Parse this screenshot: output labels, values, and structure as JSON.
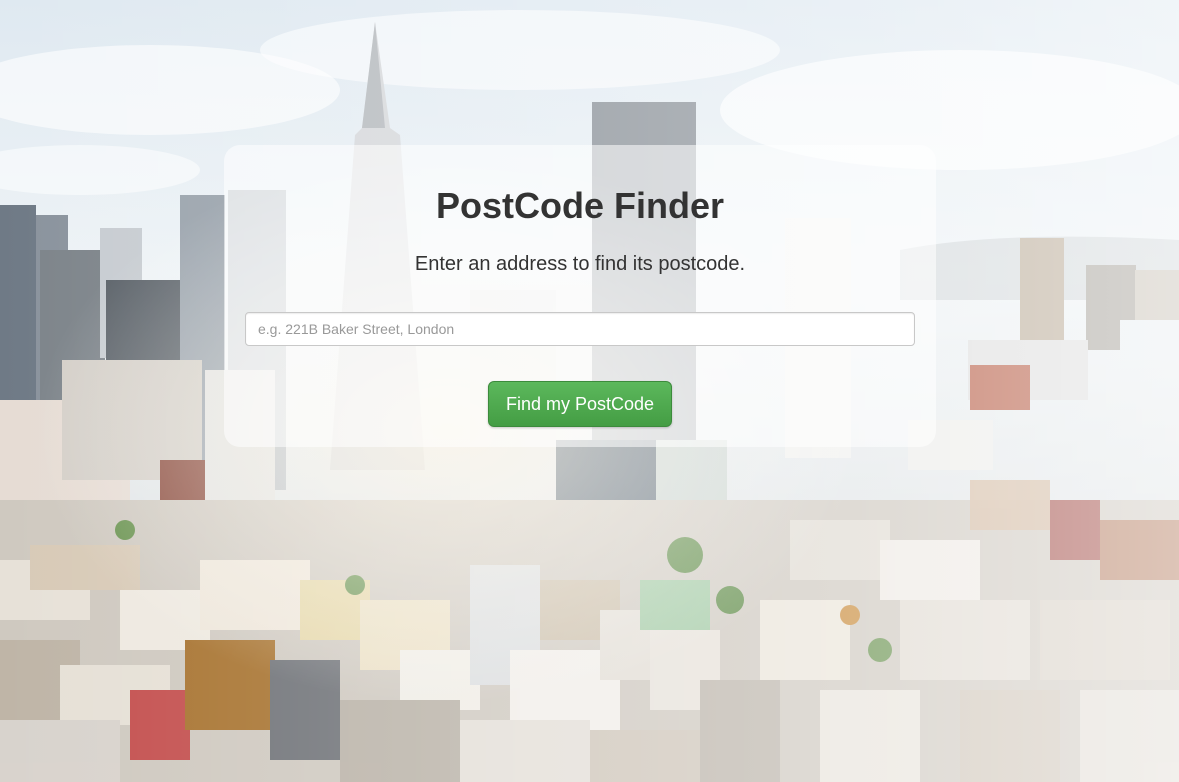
{
  "app": {
    "title": "PostCode Finder",
    "subtitle": "Enter an address to find its postcode."
  },
  "search": {
    "placeholder": "e.g. 221B Baker Street, London",
    "value": ""
  },
  "actions": {
    "find_label": "Find my PostCode"
  },
  "colors": {
    "button_green": "#4cae4c",
    "text_dark": "#333333",
    "card_background": "rgba(255,255,255,0.55)"
  }
}
